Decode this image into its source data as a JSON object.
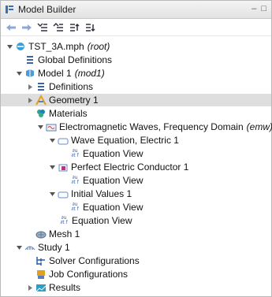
{
  "panel": {
    "title": "Model Builder"
  },
  "tree": {
    "root_label": "TST_3A.mph",
    "root_tag": "(root)",
    "global_definitions": "Global Definitions",
    "model_label": "Model 1",
    "model_tag": "(mod1)",
    "definitions": "Definitions",
    "geometry": "Geometry 1",
    "materials": "Materials",
    "physics_label": "Electromagnetic Waves, Frequency Domain",
    "physics_tag": "(emw)",
    "wave_eq": "Wave Equation, Electric 1",
    "eq_view_1": "Equation View",
    "pec": "Perfect Electric Conductor 1",
    "eq_view_2": "Equation View",
    "initial_values": "Initial Values 1",
    "eq_view_3": "Equation View",
    "eq_view_4": "Equation View",
    "mesh": "Mesh 1",
    "study": "Study 1",
    "solver_configs": "Solver Configurations",
    "job_configs": "Job Configurations",
    "results": "Results"
  },
  "colors": {
    "selection": "#dedede",
    "accent": "#3a63b0"
  }
}
